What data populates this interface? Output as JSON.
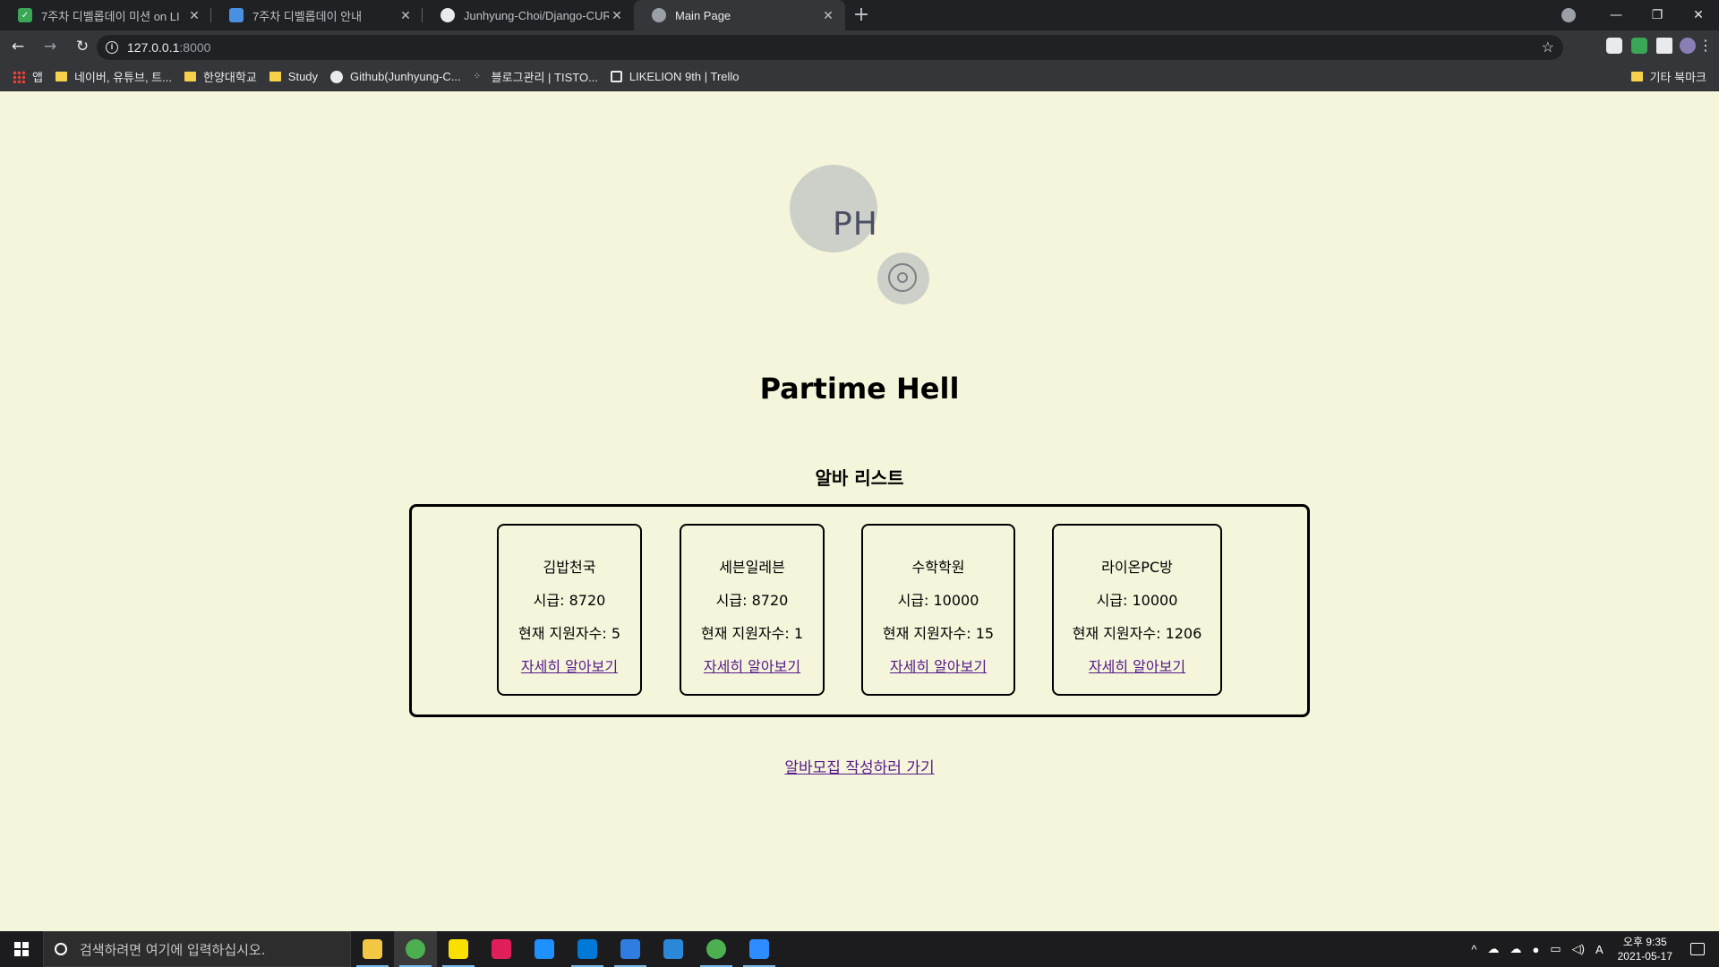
{
  "browser": {
    "tabs": [
      {
        "title": "7주차 디벨롭데이 미션 on LI",
        "icon": "check-icon",
        "color": "#3aa757",
        "active": false
      },
      {
        "title": "7주차 디벨롭데이 안내",
        "icon": "whale-icon",
        "color": "#4a90e2",
        "active": false
      },
      {
        "title": "Junhyung-Choi/Django-CURD",
        "icon": "github-icon",
        "color": "#e8eaed",
        "active": false
      },
      {
        "title": "Main Page",
        "icon": "globe-icon",
        "color": "#9aa0a6",
        "active": true
      }
    ],
    "new_tab": "+",
    "url_host": "127.0.0.1",
    "url_port": ":8000",
    "bookmarks": [
      {
        "label": "앱",
        "icon": "apps-grid-icon"
      },
      {
        "label": "네이버, 유튜브, 트...",
        "icon": "folder-icon"
      },
      {
        "label": "한양대학교",
        "icon": "folder-icon"
      },
      {
        "label": "Study",
        "icon": "folder-icon"
      },
      {
        "label": "Github(Junhyung-C...",
        "icon": "github-icon"
      },
      {
        "label": "블로그관리 | TISTO...",
        "icon": "tistory-icon"
      },
      {
        "label": "LIKELION 9th | Trello",
        "icon": "trello-icon"
      }
    ],
    "other_bookmarks": "기타 북마크"
  },
  "page": {
    "logo_text": "PH",
    "title": "Partime Hell",
    "list_title": "알바 리스트",
    "jobs": [
      {
        "name": "김밥천국",
        "wage": "시급: 8720",
        "applicants": "현재 지원자수: 5",
        "link": "자세히 알아보기"
      },
      {
        "name": "세븐일레븐",
        "wage": "시급: 8720",
        "applicants": "현재 지원자수: 1",
        "link": "자세히 알아보기"
      },
      {
        "name": "수학학원",
        "wage": "시급: 10000",
        "applicants": "현재 지원자수: 15",
        "link": "자세히 알아보기"
      },
      {
        "name": "라이온PC방",
        "wage": "시급: 10000",
        "applicants": "현재 지원자수: 1206",
        "link": "자세히 알아보기"
      }
    ],
    "write_link": "알바모집 작성하러 가기"
  },
  "taskbar": {
    "search_placeholder": "검색하려면 여기에 입력하십시오.",
    "time": "오후 9:35",
    "date": "2021-05-17",
    "ime": "A",
    "apps": [
      {
        "name": "file-explorer-icon",
        "color": "#f2c744"
      },
      {
        "name": "chrome-icon",
        "color": "#4caf50"
      },
      {
        "name": "kakaotalk-icon",
        "color": "#f9e000"
      },
      {
        "name": "slack-icon",
        "color": "#e01e5a"
      },
      {
        "name": "mail-icon",
        "color": "#1e90ff"
      },
      {
        "name": "vscode-icon",
        "color": "#0078d7"
      },
      {
        "name": "todo-icon",
        "color": "#2f7de1"
      },
      {
        "name": "azure-icon",
        "color": "#2b88d8"
      },
      {
        "name": "chrome-icon-2",
        "color": "#4caf50"
      },
      {
        "name": "zoom-icon",
        "color": "#2d8cff"
      }
    ]
  }
}
